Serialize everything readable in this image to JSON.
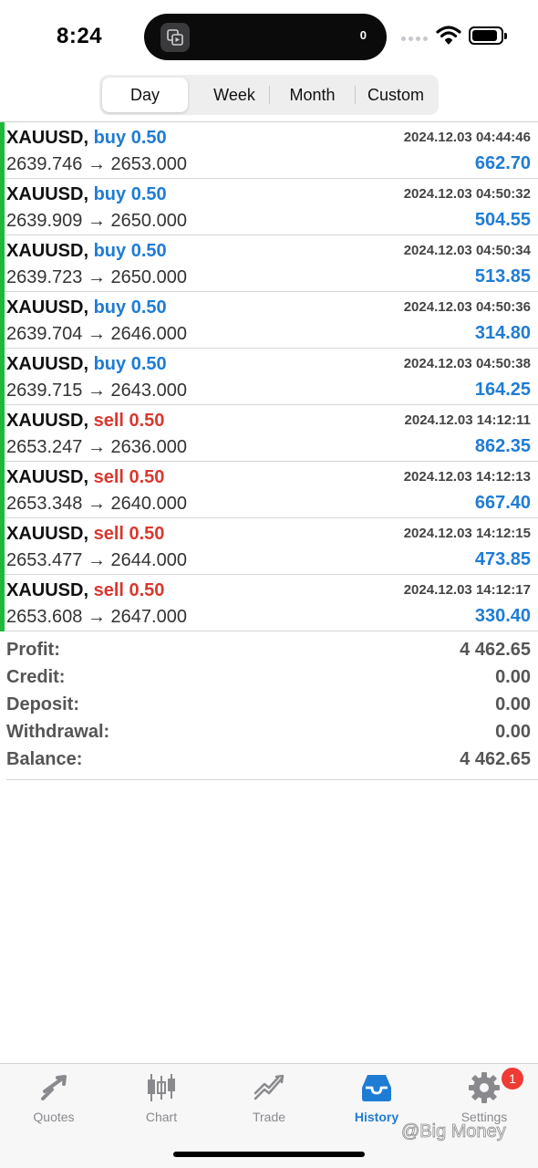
{
  "status_bar": {
    "time": "8:24",
    "island_count": "0"
  },
  "segments": [
    {
      "label": "Day",
      "active": true
    },
    {
      "label": "Week",
      "active": false
    },
    {
      "label": "Month",
      "active": false
    },
    {
      "label": "Custom",
      "active": false
    }
  ],
  "deals": [
    {
      "symbol": "XAUUSD,",
      "type": "buy 0.50",
      "side": "buy",
      "timestamp": "2024.12.03 04:44:46",
      "prices": "2639.746 → 2653.000",
      "profit": "662.70"
    },
    {
      "symbol": "XAUUSD,",
      "type": "buy 0.50",
      "side": "buy",
      "timestamp": "2024.12.03 04:50:32",
      "prices": "2639.909 → 2650.000",
      "profit": "504.55"
    },
    {
      "symbol": "XAUUSD,",
      "type": "buy 0.50",
      "side": "buy",
      "timestamp": "2024.12.03 04:50:34",
      "prices": "2639.723 → 2650.000",
      "profit": "513.85"
    },
    {
      "symbol": "XAUUSD,",
      "type": "buy 0.50",
      "side": "buy",
      "timestamp": "2024.12.03 04:50:36",
      "prices": "2639.704 → 2646.000",
      "profit": "314.80"
    },
    {
      "symbol": "XAUUSD,",
      "type": "buy 0.50",
      "side": "buy",
      "timestamp": "2024.12.03 04:50:38",
      "prices": "2639.715 → 2643.000",
      "profit": "164.25"
    },
    {
      "symbol": "XAUUSD,",
      "type": "sell 0.50",
      "side": "sell",
      "timestamp": "2024.12.03 14:12:11",
      "prices": "2653.247 → 2636.000",
      "profit": "862.35"
    },
    {
      "symbol": "XAUUSD,",
      "type": "sell 0.50",
      "side": "sell",
      "timestamp": "2024.12.03 14:12:13",
      "prices": "2653.348 → 2640.000",
      "profit": "667.40"
    },
    {
      "symbol": "XAUUSD,",
      "type": "sell 0.50",
      "side": "sell",
      "timestamp": "2024.12.03 14:12:15",
      "prices": "2653.477 → 2644.000",
      "profit": "473.85"
    },
    {
      "symbol": "XAUUSD,",
      "type": "sell 0.50",
      "side": "sell",
      "timestamp": "2024.12.03 14:12:17",
      "prices": "2653.608 → 2647.000",
      "profit": "330.40"
    }
  ],
  "summary": [
    {
      "label": "Profit:",
      "value": "4 462.65"
    },
    {
      "label": "Credit:",
      "value": "0.00"
    },
    {
      "label": "Deposit:",
      "value": "0.00"
    },
    {
      "label": "Withdrawal:",
      "value": "0.00"
    },
    {
      "label": "Balance:",
      "value": "4 462.65"
    }
  ],
  "tabs": [
    {
      "label": "Quotes",
      "icon": "quotes-icon",
      "active": false
    },
    {
      "label": "Chart",
      "icon": "chart-icon",
      "active": false
    },
    {
      "label": "Trade",
      "icon": "trade-icon",
      "active": false
    },
    {
      "label": "History",
      "icon": "history-icon",
      "active": true
    },
    {
      "label": "Settings",
      "icon": "settings-icon",
      "active": false,
      "badge": "1"
    }
  ],
  "watermark": "@Big Money",
  "colors": {
    "buy": "#1f7cd4",
    "sell": "#d8392f",
    "profit": "#1f7cd4",
    "row_indicator": "#1fb93a",
    "tab_active": "#1f7cd4",
    "badge": "#ee3b34"
  }
}
